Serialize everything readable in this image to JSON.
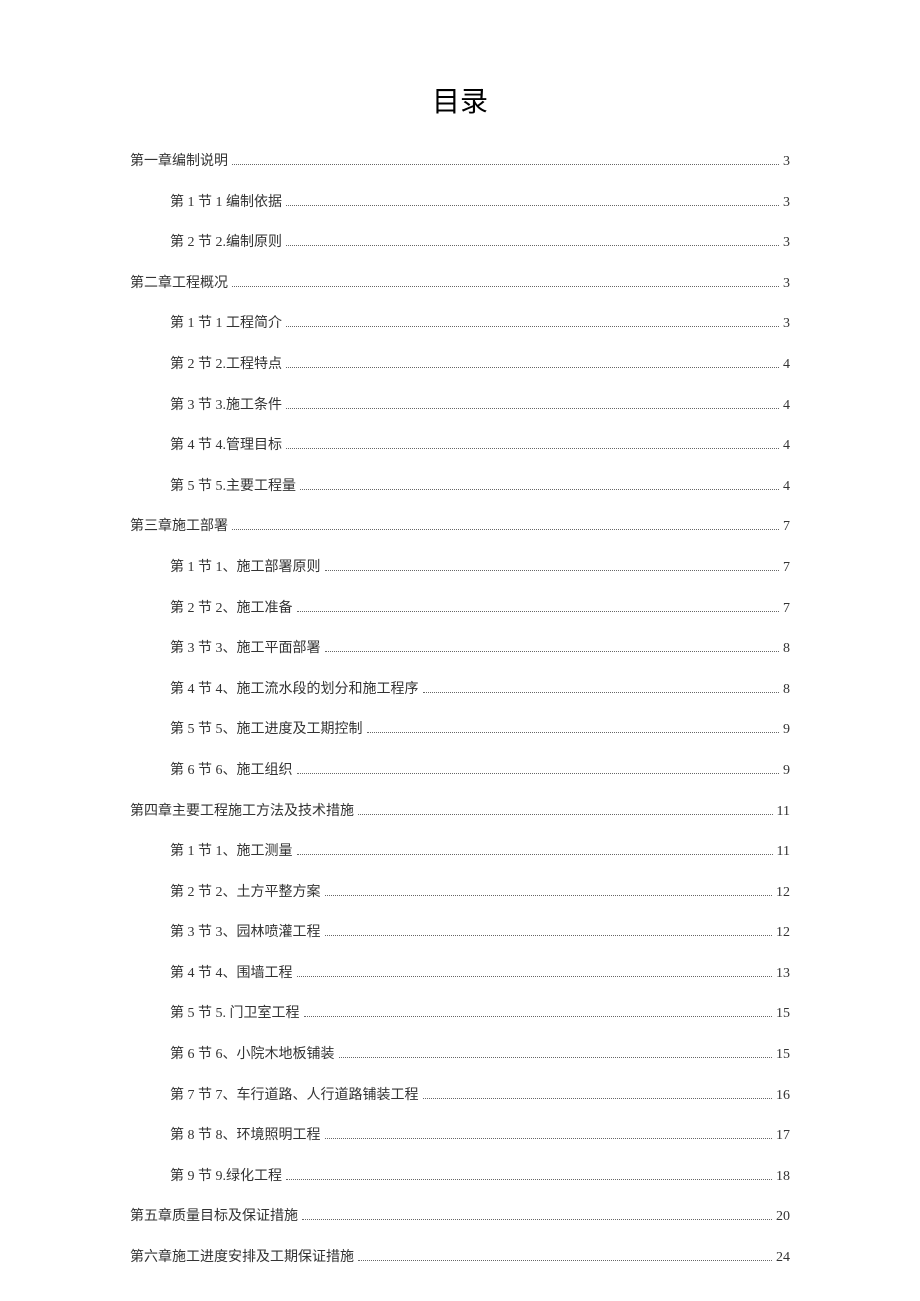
{
  "title": "目录",
  "entries": [
    {
      "level": 1,
      "label": "第一章编制说明",
      "page": "3"
    },
    {
      "level": 2,
      "label": "第 1 节 1 编制依据",
      "page": "3"
    },
    {
      "level": 2,
      "label": "第 2 节 2.编制原则",
      "page": "3"
    },
    {
      "level": 1,
      "label": "第二章工程概况",
      "page": "3"
    },
    {
      "level": 2,
      "label": "第 1 节 1 工程简介",
      "page": "3"
    },
    {
      "level": 2,
      "label": "第 2 节 2.工程特点",
      "page": "4"
    },
    {
      "level": 2,
      "label": "第 3 节 3.施工条件",
      "page": "4"
    },
    {
      "level": 2,
      "label": "第 4 节 4.管理目标",
      "page": "4"
    },
    {
      "level": 2,
      "label": "第 5 节 5.主要工程量",
      "page": "4"
    },
    {
      "level": 1,
      "label": "第三章施工部署",
      "page": "7"
    },
    {
      "level": 2,
      "label": "第 1 节 1、施工部署原则",
      "page": "7"
    },
    {
      "level": 2,
      "label": "第 2 节 2、施工准备",
      "page": "7"
    },
    {
      "level": 2,
      "label": "第 3 节 3、施工平面部署",
      "page": "8"
    },
    {
      "level": 2,
      "label": "第 4 节 4、施工流水段的划分和施工程序",
      "page": "8"
    },
    {
      "level": 2,
      "label": "第 5 节 5、施工进度及工期控制",
      "page": "9"
    },
    {
      "level": 2,
      "label": "第 6 节 6、施工组织",
      "page": "9"
    },
    {
      "level": 1,
      "label": "第四章主要工程施工方法及技术措施",
      "page": "11"
    },
    {
      "level": 2,
      "label": "第 1 节 1、施工测量",
      "page": "11"
    },
    {
      "level": 2,
      "label": "第 2 节 2、土方平整方案",
      "page": "12"
    },
    {
      "level": 2,
      "label": "第 3 节 3、园林喷灌工程",
      "page": "12"
    },
    {
      "level": 2,
      "label": "第 4 节 4、围墙工程",
      "page": "13"
    },
    {
      "level": 2,
      "label": "第 5 节 5. 门卫室工程",
      "page": "15"
    },
    {
      "level": 2,
      "label": "第 6 节 6、小院木地板铺装",
      "page": "15"
    },
    {
      "level": 2,
      "label": "第 7 节 7、车行道路、人行道路铺装工程",
      "page": "16"
    },
    {
      "level": 2,
      "label": "第 8 节 8、环境照明工程",
      "page": "17"
    },
    {
      "level": 2,
      "label": "第 9 节 9.绿化工程",
      "page": "18"
    },
    {
      "level": 1,
      "label": "第五章质量目标及保证措施",
      "page": "20"
    },
    {
      "level": 1,
      "label": "第六章施工进度安排及工期保证措施",
      "page": "24"
    }
  ]
}
